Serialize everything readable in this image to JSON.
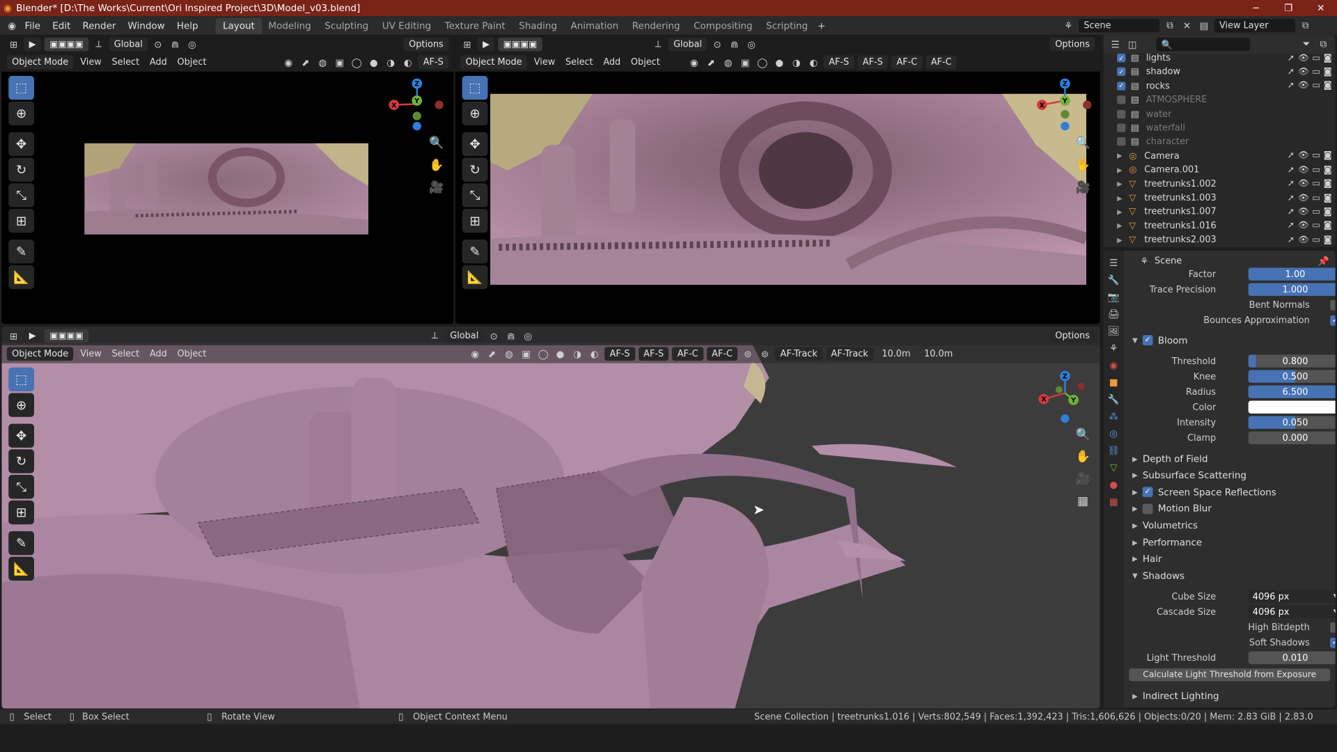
{
  "window": {
    "title": "Blender* [D:\\The Works\\Current\\Ori Inspired Project\\3D\\Model_v03.blend]"
  },
  "menu": [
    "File",
    "Edit",
    "Render",
    "Window",
    "Help"
  ],
  "workspace_tabs": [
    "Layout",
    "Modeling",
    "Sculpting",
    "UV Editing",
    "Texture Paint",
    "Shading",
    "Animation",
    "Rendering",
    "Compositing",
    "Scripting"
  ],
  "active_workspace": "Layout",
  "scene_field": "Scene",
  "view_layer_field": "View Layer",
  "viewport_header": {
    "orientation": "Global",
    "options": "Options",
    "mode": "Object Mode",
    "view": "View",
    "select": "Select",
    "add": "Add",
    "object": "Object",
    "af_s": "AF-S",
    "af_c": "AF-C",
    "af_track": "AF-Track",
    "distance": "10.0m"
  },
  "gizmo_axes": {
    "x": "X",
    "y": "Y",
    "z": "Z"
  },
  "outliner": {
    "items": [
      {
        "name": "lights",
        "checked": true,
        "dim": false,
        "type": "collection"
      },
      {
        "name": "shadow",
        "checked": true,
        "dim": false,
        "type": "collection"
      },
      {
        "name": "rocks",
        "checked": true,
        "dim": false,
        "type": "collection"
      },
      {
        "name": "ATMOSPHERE",
        "checked": false,
        "dim": true,
        "type": "collection"
      },
      {
        "name": "water",
        "checked": false,
        "dim": true,
        "type": "collection"
      },
      {
        "name": "waterfall",
        "checked": false,
        "dim": true,
        "type": "collection"
      },
      {
        "name": "character",
        "checked": false,
        "dim": true,
        "type": "collection"
      },
      {
        "name": "Camera",
        "type": "camera"
      },
      {
        "name": "Camera.001",
        "type": "camera"
      },
      {
        "name": "treetrunks1.002",
        "type": "mesh"
      },
      {
        "name": "treetrunks1.003",
        "type": "mesh"
      },
      {
        "name": "treetrunks1.007",
        "type": "mesh"
      },
      {
        "name": "treetrunks1.016",
        "type": "mesh"
      },
      {
        "name": "treetrunks2.003",
        "type": "mesh"
      }
    ]
  },
  "properties": {
    "context": "Scene",
    "ao": {
      "factor_label": "Factor",
      "factor": "1.00",
      "trace_label": "Trace Precision",
      "trace": "1.000",
      "bent_label": "Bent Normals",
      "bounces_label": "Bounces Approximation"
    },
    "bloom": {
      "title": "Bloom",
      "threshold_label": "Threshold",
      "threshold": "0.800",
      "threshold_level": 0.08,
      "knee_label": "Knee",
      "knee": "0.500",
      "knee_level": 0.5,
      "radius_label": "Radius",
      "radius": "6.500",
      "radius_level": 1.0,
      "color_label": "Color",
      "intensity_label": "Intensity",
      "intensity": "0.050",
      "intensity_level": 0.5,
      "clamp_label": "Clamp",
      "clamp": "0.000"
    },
    "sections": [
      "Depth of Field",
      "Subsurface Scattering",
      "Screen Space Reflections",
      "Motion Blur",
      "Volumetrics",
      "Performance",
      "Hair",
      "Shadows"
    ],
    "shadows": {
      "cube_label": "Cube Size",
      "cube": "4096 px",
      "cascade_label": "Cascade Size",
      "cascade": "4096 px",
      "bitdepth_label": "High Bitdepth",
      "soft_label": "Soft Shadows",
      "light_thresh_label": "Light Threshold",
      "light_thresh": "0.010",
      "calc_button": "Calculate Light Threshold from Exposure"
    },
    "indirect": "Indirect Lighting"
  },
  "statusbar": {
    "select": "Select",
    "box_select": "Box Select",
    "rotate": "Rotate View",
    "context_menu": "Object Context Menu",
    "info": "Scene Collection | treetrunks1.016 | Verts:802,549 | Faces:1,392,423 | Tris:1,606,626 | Objects:0/20 | Mem: 2.83 GiB | 2.83.0"
  }
}
